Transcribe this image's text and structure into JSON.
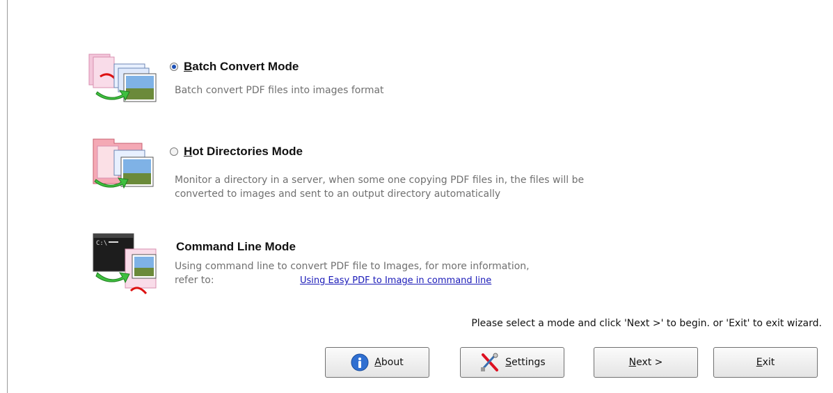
{
  "modes": [
    {
      "title_first": "B",
      "title_rest": "atch Convert Mode",
      "selected": true,
      "description": "Batch convert PDF files into images format",
      "icon": "batch-convert-icon"
    },
    {
      "title_first": "H",
      "title_rest": "ot Directories Mode",
      "selected": false,
      "description_line1": "Monitor a directory in a server, when some one copying PDF files in, the files will be",
      "description_line2": "converted to images and sent to an output directory automatically",
      "icon": "hot-directories-icon"
    },
    {
      "title": "Command Line Mode",
      "description_line1": "Using command line to convert PDF file to Images, for more information,",
      "description_line2_prefix": "refer to:",
      "link_text": "Using Easy PDF to Image in command line",
      "icon": "command-line-icon"
    }
  ],
  "hint": "Please select a mode and click 'Next >' to begin. or 'Exit' to exit wizard.",
  "buttons": {
    "about": {
      "first": "A",
      "rest": "bout",
      "icon": "info-icon"
    },
    "settings": {
      "first": "S",
      "rest": "ettings",
      "icon": "tools-icon"
    },
    "next": {
      "first": "N",
      "rest": "ext >"
    },
    "exit": {
      "first": "E",
      "rest": "xit"
    }
  },
  "colors": {
    "accent": "#1b4fb6",
    "link": "#1a1ab8",
    "muted_text": "#707070"
  }
}
